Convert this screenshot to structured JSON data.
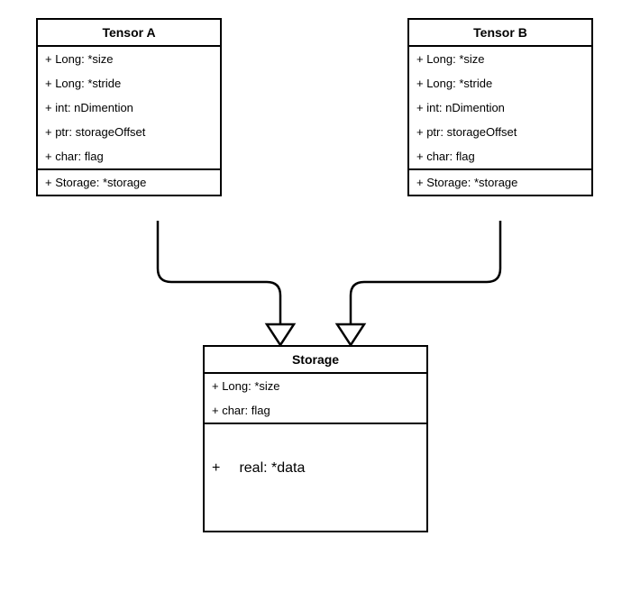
{
  "tensorA": {
    "title": "Tensor A",
    "attrs": [
      "+ Long: *size",
      "+ Long: *stride",
      "+ int:  nDimention",
      "+ ptr: storageOffset",
      "+ char: flag"
    ],
    "ref": "+ Storage: *storage"
  },
  "tensorB": {
    "title": "Tensor B",
    "attrs": [
      "+ Long: *size",
      "+ Long: *stride",
      "+ int:  nDimention",
      "+ ptr: storageOffset",
      "+ char: flag"
    ],
    "ref": "+ Storage: *storage"
  },
  "storage": {
    "title": "Storage",
    "attrs": [
      "+ Long: *size",
      "+ char: flag"
    ],
    "dataPlus": "+",
    "dataText": "real: *data"
  }
}
